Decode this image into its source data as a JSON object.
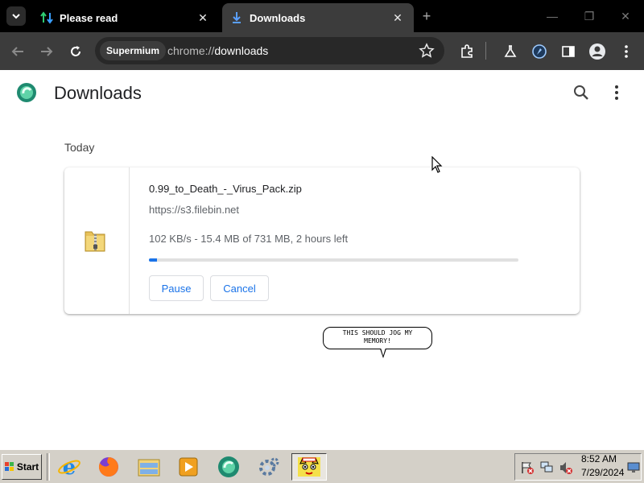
{
  "browser": {
    "tabs": [
      {
        "title": "Please read",
        "active": false
      },
      {
        "title": "Downloads",
        "active": true
      }
    ],
    "omnibox": {
      "chip": "Supermium",
      "url_scheme": "chrome://",
      "url_host": "downloads"
    }
  },
  "page": {
    "title": "Downloads",
    "section": "Today",
    "download": {
      "file_name": "0.99_to_Death_-_Virus_Pack.zip",
      "source": "https://s3.filebin.net",
      "status": "102 KB/s - 15.4 MB of 731 MB, 2 hours left",
      "progress": 0.021,
      "pause_label": "Pause",
      "cancel_label": "Cancel"
    }
  },
  "overlay": {
    "bubble_line1": "THIS SHOULD JOG MY",
    "bubble_line2": "MEMORY!"
  },
  "taskbar": {
    "start_label": "Start",
    "time": "8:52 AM",
    "date": "7/29/2024",
    "apps": [
      "internet-explorer-icon",
      "firefox-icon",
      "file-manager-icon",
      "media-player-icon",
      "supermium-icon",
      "settings-icon",
      "cat-app-icon"
    ]
  },
  "colors": {
    "accent": "#1a73e8",
    "tab_bar": "#000000",
    "toolbar": "#3c3c3c",
    "taskbar": "#d4d0c8"
  }
}
